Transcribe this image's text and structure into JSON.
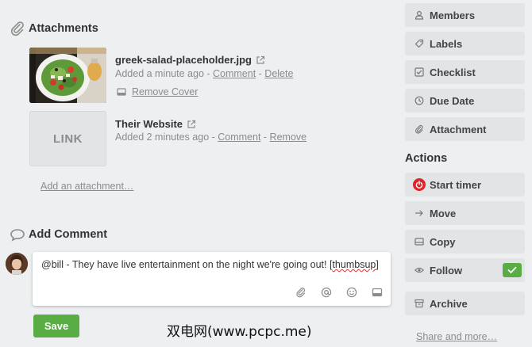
{
  "attachments": {
    "title": "Attachments",
    "items": [
      {
        "name": "greek-salad-placeholder.jpg",
        "added": "Added a minute ago",
        "sep1": " - ",
        "link1": "Comment",
        "sep2": " - ",
        "link2": "Delete",
        "extra_action": "Remove Cover",
        "thumb_icon": "salad-photo"
      },
      {
        "name": "Their Website",
        "added": "Added 2 minutes ago",
        "sep1": " - ",
        "link1": "Comment",
        "sep2": " - ",
        "link2": "Remove",
        "thumb_label": "LINK"
      }
    ],
    "add_label": "Add an attachment…"
  },
  "comment": {
    "title": "Add Comment",
    "text_before": "@bill - They have live entertainment on the night we're going out! [",
    "text_spell": "thumbsup",
    "text_after": "]",
    "tools": [
      "attachment-icon",
      "mention-icon",
      "emoji-icon",
      "card-icon"
    ],
    "save_label": "Save"
  },
  "sidebar": {
    "add_items": [
      {
        "label": "Members",
        "icon": "person-icon"
      },
      {
        "label": "Labels",
        "icon": "tag-icon"
      },
      {
        "label": "Checklist",
        "icon": "checkbox-icon"
      },
      {
        "label": "Due Date",
        "icon": "clock-icon"
      },
      {
        "label": "Attachment",
        "icon": "paperclip-icon"
      }
    ],
    "actions_title": "Actions",
    "actions": [
      {
        "label": "Start timer",
        "icon": "power-icon"
      },
      {
        "label": "Move",
        "icon": "arrow-right-icon"
      },
      {
        "label": "Copy",
        "icon": "copy-icon"
      },
      {
        "label": "Follow",
        "icon": "eye-icon",
        "checked": true
      },
      {
        "label": "Archive",
        "icon": "archive-icon"
      }
    ],
    "share_label": "Share and more…"
  },
  "watermark": "双电网(www.pcpc.me)",
  "colors": {
    "background": "#edeff0",
    "button_bg": "#e2e4e6",
    "save_green": "#5aac44",
    "timer_red": "#e0232a",
    "muted_text": "#8c8c8c"
  }
}
